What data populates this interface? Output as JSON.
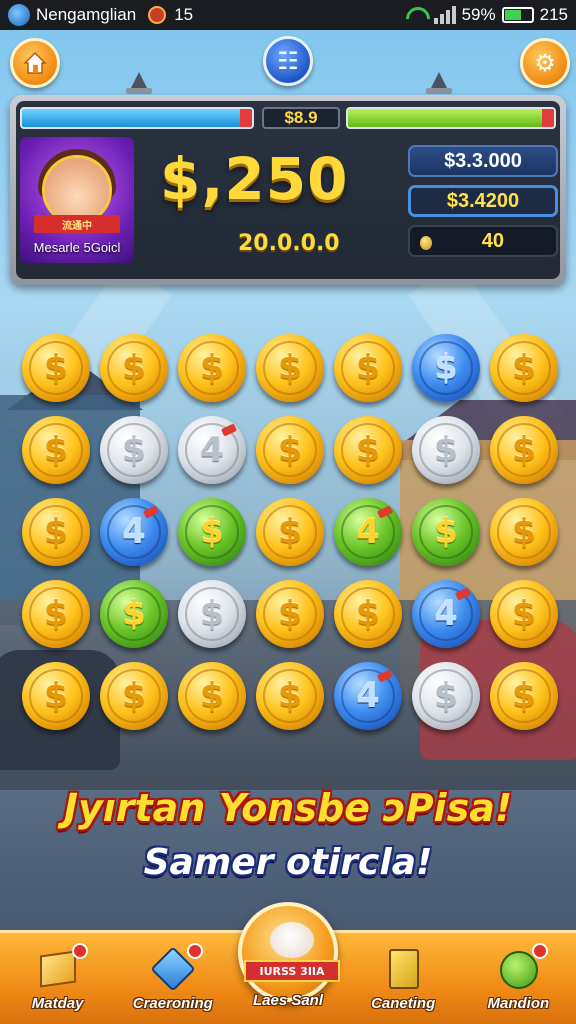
{
  "status_bar": {
    "app_name": "Nengamglian",
    "notification_count": "15",
    "battery_percent": "59%",
    "battery_level": 0.59,
    "time": "215"
  },
  "top_buttons": {
    "home_icon": "home-icon",
    "menu_icon": "menu-icon",
    "menu_symbol": "☷",
    "settings_icon": "settings-icon",
    "settings_symbol": "⚙"
  },
  "panel": {
    "bar_value": "$8.9",
    "player_name": "Mesarle 5Goicl",
    "ribbon_text": "流通中",
    "money": "$,250",
    "sub_money": "20.0.0.0",
    "stats": [
      "$3.3.000",
      "$3.4200",
      "40"
    ]
  },
  "grid": {
    "rows": [
      [
        {
          "type": "gold",
          "symbol": "$"
        },
        {
          "type": "gold",
          "symbol": "$"
        },
        {
          "type": "gold",
          "symbol": "$"
        },
        {
          "type": "gold",
          "symbol": "$"
        },
        {
          "type": "gold",
          "symbol": "$"
        },
        {
          "type": "blue",
          "symbol": "$"
        },
        {
          "type": "gold",
          "symbol": "$"
        }
      ],
      [
        {
          "type": "gold",
          "symbol": "$"
        },
        {
          "type": "silver",
          "symbol": "$"
        },
        {
          "type": "silver",
          "symbol": "4"
        },
        {
          "type": "gold",
          "symbol": "$"
        },
        {
          "type": "gold",
          "symbol": "$"
        },
        {
          "type": "silver",
          "symbol": "$"
        },
        {
          "type": "gold",
          "symbol": "$"
        }
      ],
      [
        {
          "type": "gold",
          "symbol": "$"
        },
        {
          "type": "blue",
          "symbol": "4"
        },
        {
          "type": "green",
          "symbol": "$"
        },
        {
          "type": "gold",
          "symbol": "$"
        },
        {
          "type": "green",
          "symbol": "4"
        },
        {
          "type": "green",
          "symbol": "$"
        },
        {
          "type": "gold",
          "symbol": "$"
        }
      ],
      [
        {
          "type": "gold",
          "symbol": "$"
        },
        {
          "type": "green",
          "symbol": "$"
        },
        {
          "type": "silver",
          "symbol": "$"
        },
        {
          "type": "gold",
          "symbol": "$"
        },
        {
          "type": "gold",
          "symbol": "$"
        },
        {
          "type": "blue",
          "symbol": "4"
        },
        {
          "type": "gold",
          "symbol": "$"
        }
      ],
      [
        {
          "type": "gold",
          "symbol": "$"
        },
        {
          "type": "gold",
          "symbol": "$"
        },
        {
          "type": "gold",
          "symbol": "$"
        },
        {
          "type": "gold",
          "symbol": "$"
        },
        {
          "type": "blue",
          "symbol": "4"
        },
        {
          "type": "silver",
          "symbol": "$"
        },
        {
          "type": "gold",
          "symbol": "$"
        }
      ]
    ]
  },
  "promo": {
    "line1": "Jyırtan Yonsbe ɔPisa!",
    "line2": "Samer otircla!"
  },
  "bottom_nav": {
    "items": [
      {
        "label": "Matday",
        "icon": "box-icon"
      },
      {
        "label": "Craeroning",
        "icon": "tag-icon"
      },
      {
        "label": "Laes Sanl",
        "icon": "fortune-cookie-icon",
        "ribbon": "IURSS 3IIA"
      },
      {
        "label": "Caneting",
        "icon": "book-icon"
      },
      {
        "label": "Mandion",
        "icon": "leaf-icon"
      }
    ]
  },
  "colors": {
    "gold_text": "#ffd93a",
    "promo_red_outline": "#a8160f",
    "nav_orange": "#f08b16"
  }
}
